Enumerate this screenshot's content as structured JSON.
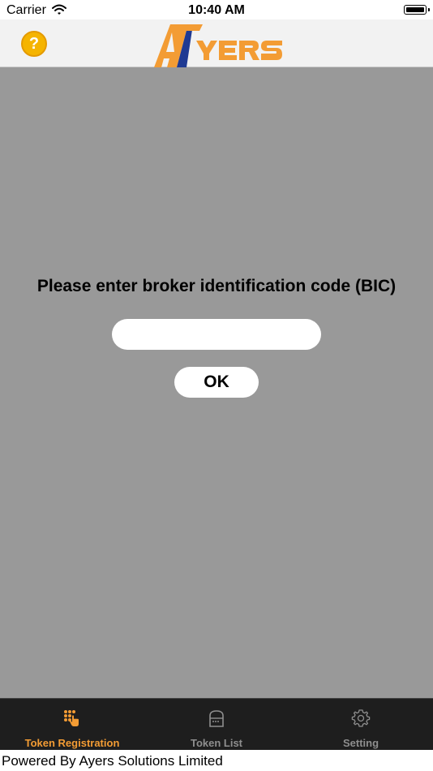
{
  "status_bar": {
    "carrier": "Carrier",
    "time": "10:40 AM",
    "wifi_icon": "wifi-icon",
    "battery_icon": "battery-icon"
  },
  "nav": {
    "help_icon": "question-icon",
    "help_label": "?",
    "logo_text": "AYERS",
    "logo_color": "#f39c34",
    "logo_accent": "#1f3a93"
  },
  "main": {
    "background": "#999999",
    "prompt": "Please enter broker identification code (BIC)",
    "bic_input": {
      "value": "",
      "placeholder": ""
    },
    "ok_label": "OK"
  },
  "tabs": [
    {
      "label": "Token Registration",
      "icon": "keypad-hand-icon",
      "active": true
    },
    {
      "label": "Token List",
      "icon": "token-device-icon",
      "active": false
    },
    {
      "label": "Setting",
      "icon": "gear-icon",
      "active": false
    }
  ],
  "colors": {
    "active_tab": "#f39c34",
    "inactive_tab": "#8e8e8e",
    "tab_bar": "#1e1e1e"
  },
  "footer": {
    "text": "Powered By Ayers Solutions Limited"
  }
}
